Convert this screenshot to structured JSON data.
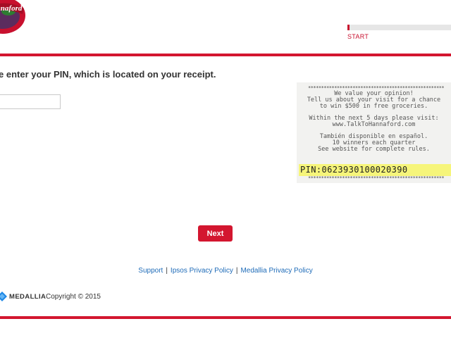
{
  "header": {
    "logo_text": "Hannaford",
    "progress": {
      "label": "START",
      "value": 0.02
    }
  },
  "main": {
    "question": "e enter your PIN, which is located on your receipt.",
    "pin_input": {
      "value": "",
      "placeholder": ""
    },
    "receipt": {
      "stars": "****************************************************",
      "lines": [
        "We value your opinion!",
        "Tell us about your visit for a chance",
        "to win $500 in free groceries.",
        "",
        "Within the next 5 days please visit:",
        "www.TalkToHannaford.com",
        "",
        "También disponible en español.",
        "10 winners each quarter",
        "See website for complete rules."
      ],
      "pin_text": "PIN:0623930100020390"
    },
    "next_label": "Next"
  },
  "footer": {
    "links": [
      "Support",
      "Ipsos Privacy Policy",
      "Medallia Privacy Policy"
    ],
    "separator": "|",
    "brand_name": "MEDALLIA",
    "copyright": "Copyright © 2015"
  },
  "colors": {
    "accent": "#d3162f",
    "link": "#1e6bb8",
    "text": "#333333",
    "pin_highlight": "#f6f57a"
  }
}
